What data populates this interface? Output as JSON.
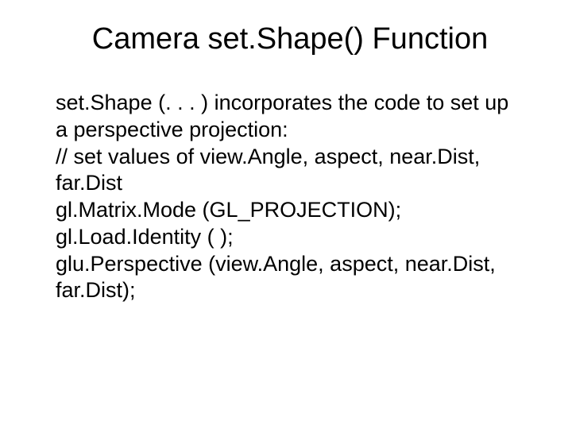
{
  "slide": {
    "title": "Camera set.Shape() Function",
    "body": {
      "p1": "set.Shape (. . . ) incorporates the code to set up a perspective projection:",
      "p2": "// set values of view.Angle, aspect, near.Dist, far.Dist",
      "p3": "gl.Matrix.Mode (GL_PROJECTION);",
      "p4": "gl.Load.Identity ( );",
      "p5": "glu.Perspective (view.Angle, aspect, near.Dist, far.Dist);"
    }
  }
}
